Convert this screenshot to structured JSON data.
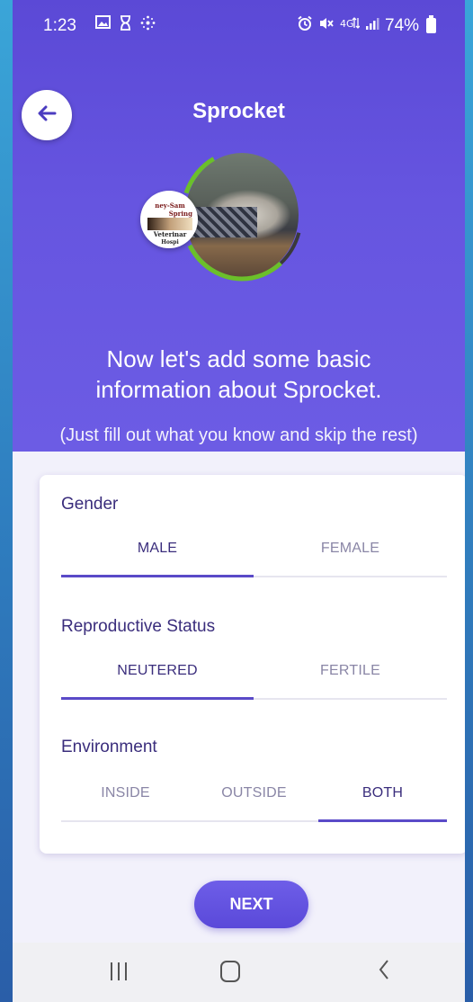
{
  "status_bar": {
    "time": "1:23",
    "battery_percent": "74%",
    "left_icons": [
      "image-icon",
      "hourglass-icon",
      "grid-dots-icon"
    ],
    "right_icons": [
      "alarm-icon",
      "mute-icon",
      "lte-signal-icon",
      "signal-bars-icon"
    ]
  },
  "header": {
    "title": "Sprocket",
    "back_icon": "arrow-left-icon"
  },
  "clinic_badge": {
    "line1": "ney-Sam",
    "line2": "Spring",
    "line3": "Veterinar",
    "line4": "Hospi"
  },
  "intro": {
    "headline": "Now let's add some basic information about Sprocket.",
    "subline": "(Just fill out what you know and skip the rest)"
  },
  "form": {
    "gender": {
      "label": "Gender",
      "options": [
        "MALE",
        "FEMALE"
      ],
      "selected": "MALE"
    },
    "reproductive_status": {
      "label": "Reproductive Status",
      "options": [
        "NEUTERED",
        "FERTILE"
      ],
      "selected": "NEUTERED"
    },
    "environment": {
      "label": "Environment",
      "options": [
        "INSIDE",
        "OUTSIDE",
        "BOTH"
      ],
      "selected": "BOTH"
    }
  },
  "actions": {
    "next_label": "NEXT"
  },
  "colors": {
    "accent": "#5a4ac8",
    "hero_top": "#5b49d6",
    "hero_bottom": "#6c5ce4",
    "label": "#3a2d7c",
    "ring_green": "#6bbf2a"
  },
  "nav_bar": {
    "icons": [
      "recent-apps-icon",
      "home-icon",
      "back-nav-icon"
    ]
  }
}
